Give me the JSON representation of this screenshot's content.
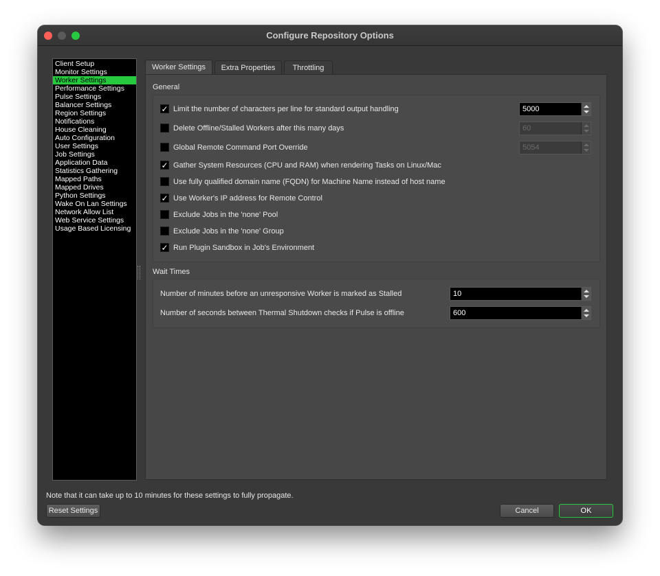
{
  "window": {
    "title": "Configure Repository Options"
  },
  "sidebar": {
    "items": [
      {
        "label": "Client Setup"
      },
      {
        "label": "Monitor Settings"
      },
      {
        "label": "Worker Settings",
        "active": true
      },
      {
        "label": "Performance Settings"
      },
      {
        "label": "Pulse Settings"
      },
      {
        "label": "Balancer Settings"
      },
      {
        "label": "Region Settings"
      },
      {
        "label": "Notifications"
      },
      {
        "label": "House Cleaning"
      },
      {
        "label": "Auto Configuration"
      },
      {
        "label": "User Settings"
      },
      {
        "label": "Job Settings"
      },
      {
        "label": "Application Data"
      },
      {
        "label": "Statistics Gathering"
      },
      {
        "label": "Mapped Paths"
      },
      {
        "label": "Mapped Drives"
      },
      {
        "label": "Python Settings"
      },
      {
        "label": "Wake On Lan Settings"
      },
      {
        "label": "Network Allow List"
      },
      {
        "label": "Web Service Settings"
      },
      {
        "label": "Usage Based Licensing"
      }
    ]
  },
  "tabs": [
    {
      "label": "Worker Settings",
      "active": true
    },
    {
      "label": "Extra Properties"
    },
    {
      "label": "Throttling"
    }
  ],
  "general": {
    "title": "General",
    "options": [
      {
        "label": "Limit the number of characters per line for standard output handling",
        "checked": true,
        "value": "5000",
        "enabled": true
      },
      {
        "label": "Delete Offline/Stalled Workers after this many days",
        "checked": false,
        "value": "60",
        "enabled": false
      },
      {
        "label": "Global Remote Command Port Override",
        "checked": false,
        "value": "5054",
        "enabled": false
      },
      {
        "label": "Gather System Resources (CPU and RAM) when rendering Tasks on Linux/Mac",
        "checked": true
      },
      {
        "label": "Use fully qualified domain name (FQDN) for Machine Name instead of host name",
        "checked": false
      },
      {
        "label": "Use Worker's IP address for Remote Control",
        "checked": true
      },
      {
        "label": "Exclude Jobs in the 'none' Pool",
        "checked": false
      },
      {
        "label": "Exclude Jobs in the 'none' Group",
        "checked": false
      },
      {
        "label": "Run Plugin Sandbox in Job's Environment",
        "checked": true
      }
    ]
  },
  "wait_times": {
    "title": "Wait Times",
    "options": [
      {
        "label": "Number of minutes before an unresponsive Worker is marked as Stalled",
        "value": "10"
      },
      {
        "label": "Number of seconds between Thermal Shutdown checks if Pulse is offline",
        "value": "600"
      }
    ]
  },
  "footer": {
    "note": "Note that it can take up to 10 minutes for these settings to fully propagate.",
    "reset_label": "Reset Settings",
    "cancel_label": "Cancel",
    "ok_label": "OK"
  },
  "colors": {
    "accent": "#27c93f",
    "background": "#393939"
  }
}
